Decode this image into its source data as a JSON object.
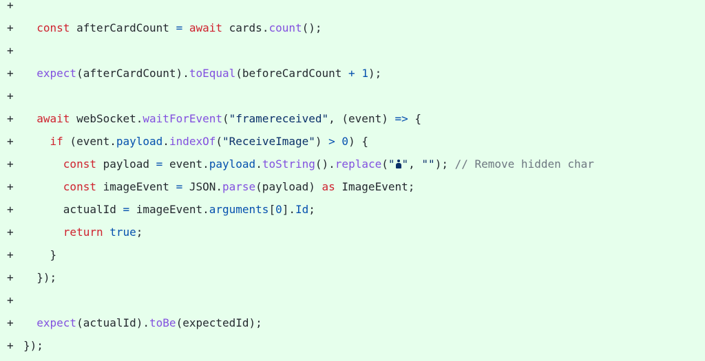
{
  "diff": {
    "marker": "+",
    "lines": [
      {
        "indent": "",
        "tokens": []
      },
      {
        "indent": "  ",
        "tokens": [
          {
            "t": "const",
            "c": "kw"
          },
          {
            "t": " afterCardCount ",
            "c": "txt"
          },
          {
            "t": "=",
            "c": "op"
          },
          {
            "t": " ",
            "c": "txt"
          },
          {
            "t": "await",
            "c": "kw"
          },
          {
            "t": " cards.",
            "c": "txt"
          },
          {
            "t": "count",
            "c": "fn"
          },
          {
            "t": "();",
            "c": "txt"
          }
        ]
      },
      {
        "indent": "",
        "tokens": []
      },
      {
        "indent": "  ",
        "tokens": [
          {
            "t": "expect",
            "c": "fn"
          },
          {
            "t": "(afterCardCount).",
            "c": "txt"
          },
          {
            "t": "toEqual",
            "c": "fn"
          },
          {
            "t": "(beforeCardCount ",
            "c": "txt"
          },
          {
            "t": "+",
            "c": "op"
          },
          {
            "t": " ",
            "c": "txt"
          },
          {
            "t": "1",
            "c": "num"
          },
          {
            "t": ");",
            "c": "txt"
          }
        ]
      },
      {
        "indent": "",
        "tokens": []
      },
      {
        "indent": "  ",
        "tokens": [
          {
            "t": "await",
            "c": "kw"
          },
          {
            "t": " webSocket.",
            "c": "txt"
          },
          {
            "t": "waitForEvent",
            "c": "fn"
          },
          {
            "t": "(",
            "c": "txt"
          },
          {
            "t": "\"framereceived\"",
            "c": "str"
          },
          {
            "t": ", (event) ",
            "c": "txt"
          },
          {
            "t": "=>",
            "c": "op"
          },
          {
            "t": " {",
            "c": "txt"
          }
        ]
      },
      {
        "indent": "    ",
        "tokens": [
          {
            "t": "if",
            "c": "kw"
          },
          {
            "t": " (event.",
            "c": "txt"
          },
          {
            "t": "payload",
            "c": "prop"
          },
          {
            "t": ".",
            "c": "txt"
          },
          {
            "t": "indexOf",
            "c": "fn"
          },
          {
            "t": "(",
            "c": "txt"
          },
          {
            "t": "\"ReceiveImage\"",
            "c": "str"
          },
          {
            "t": ") ",
            "c": "txt"
          },
          {
            "t": ">",
            "c": "op"
          },
          {
            "t": " ",
            "c": "txt"
          },
          {
            "t": "0",
            "c": "num"
          },
          {
            "t": ") {",
            "c": "txt"
          }
        ]
      },
      {
        "indent": "      ",
        "tokens": [
          {
            "t": "const",
            "c": "kw"
          },
          {
            "t": " payload ",
            "c": "txt"
          },
          {
            "t": "=",
            "c": "op"
          },
          {
            "t": " event.",
            "c": "txt"
          },
          {
            "t": "payload",
            "c": "prop"
          },
          {
            "t": ".",
            "c": "txt"
          },
          {
            "t": "toString",
            "c": "fn"
          },
          {
            "t": "().",
            "c": "txt"
          },
          {
            "t": "replace",
            "c": "fn"
          },
          {
            "t": "(",
            "c": "txt"
          },
          {
            "t": "\"",
            "c": "str"
          },
          {
            "t": "",
            "c": "glyph"
          },
          {
            "t": "\"",
            "c": "str"
          },
          {
            "t": ", ",
            "c": "txt"
          },
          {
            "t": "\"\"",
            "c": "str"
          },
          {
            "t": "); ",
            "c": "txt"
          },
          {
            "t": "// Remove hidden char",
            "c": "cmt"
          }
        ]
      },
      {
        "indent": "      ",
        "tokens": [
          {
            "t": "const",
            "c": "kw"
          },
          {
            "t": " imageEvent ",
            "c": "txt"
          },
          {
            "t": "=",
            "c": "op"
          },
          {
            "t": " JSON.",
            "c": "txt"
          },
          {
            "t": "parse",
            "c": "fn"
          },
          {
            "t": "(payload) ",
            "c": "txt"
          },
          {
            "t": "as",
            "c": "kw"
          },
          {
            "t": " ImageEvent;",
            "c": "txt"
          }
        ]
      },
      {
        "indent": "      ",
        "tokens": [
          {
            "t": "actualId ",
            "c": "txt"
          },
          {
            "t": "=",
            "c": "op"
          },
          {
            "t": " imageEvent.",
            "c": "txt"
          },
          {
            "t": "arguments",
            "c": "prop"
          },
          {
            "t": "[",
            "c": "txt"
          },
          {
            "t": "0",
            "c": "num"
          },
          {
            "t": "].",
            "c": "txt"
          },
          {
            "t": "Id",
            "c": "prop"
          },
          {
            "t": ";",
            "c": "txt"
          }
        ]
      },
      {
        "indent": "      ",
        "tokens": [
          {
            "t": "return",
            "c": "kw"
          },
          {
            "t": " ",
            "c": "txt"
          },
          {
            "t": "true",
            "c": "prop"
          },
          {
            "t": ";",
            "c": "txt"
          }
        ]
      },
      {
        "indent": "    ",
        "tokens": [
          {
            "t": "}",
            "c": "txt"
          }
        ]
      },
      {
        "indent": "  ",
        "tokens": [
          {
            "t": "});",
            "c": "txt"
          }
        ]
      },
      {
        "indent": "",
        "tokens": []
      },
      {
        "indent": "  ",
        "tokens": [
          {
            "t": "expect",
            "c": "fn"
          },
          {
            "t": "(actualId).",
            "c": "txt"
          },
          {
            "t": "toBe",
            "c": "fn"
          },
          {
            "t": "(expectedId);",
            "c": "txt"
          }
        ]
      },
      {
        "indent": "",
        "tokens": [
          {
            "t": "});",
            "c": "txt"
          }
        ]
      }
    ]
  }
}
